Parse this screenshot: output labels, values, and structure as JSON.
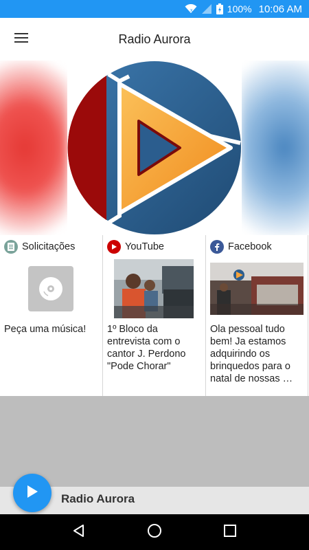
{
  "status_bar": {
    "battery": "100%",
    "time": "10:06 AM",
    "icons": [
      "wifi-icon",
      "signal-icon",
      "battery-charging-icon"
    ]
  },
  "app_bar": {
    "title": "Radio Aurora",
    "menu_icon": "hamburger-menu-icon"
  },
  "hero": {
    "logo": "radio-aurora-logo"
  },
  "cards": [
    {
      "title": "Solicitações",
      "icon": "document-icon",
      "text": "Peça uma música!",
      "image": "disc-icon"
    },
    {
      "title": "YouTube",
      "icon": "youtube-icon",
      "text": "1º Bloco da entrevista com o cantor J. Perdono \"Pode Chorar\"",
      "image": "studio-photo"
    },
    {
      "title": "Facebook",
      "icon": "facebook-icon",
      "text": "Ola pessoal tudo bem! Ja estamos adquirindo os brinquedos para o natal de nossas …",
      "image": "studio-photo"
    }
  ],
  "player": {
    "title": "Radio Aurora",
    "play_icon": "play-icon"
  },
  "navbar": {
    "icons": [
      "back-icon",
      "home-icon",
      "recents-icon"
    ]
  },
  "colors": {
    "primary": "#2196f3",
    "logo_red": "#9b0a0a",
    "logo_blue": "#2b5d8e",
    "logo_orange": "#f7a33a"
  }
}
